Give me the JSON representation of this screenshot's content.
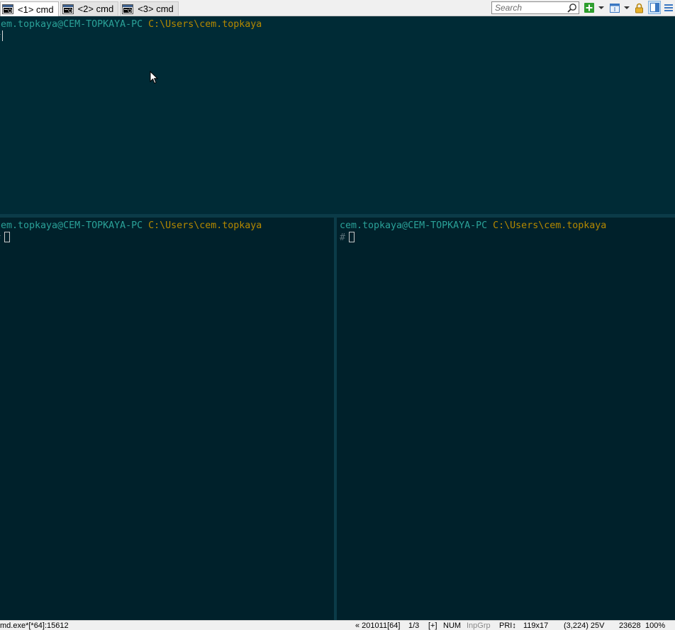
{
  "tabs": [
    {
      "label": "<1> cmd",
      "active": true
    },
    {
      "label": "<2> cmd",
      "active": false
    },
    {
      "label": "<3> cmd",
      "active": false
    }
  ],
  "search": {
    "placeholder": "Search"
  },
  "toolbar_icons": [
    "new-console-icon",
    "dropdown-arrow-icon",
    "layout-icon",
    "dropdown-arrow-icon",
    "lock-icon",
    "split-view-icon",
    "menu-icon"
  ],
  "colors": {
    "terminal_bg": "#002b36",
    "inactive_pane_bg": "#00212b",
    "prompt_user": "#2aa198",
    "prompt_path": "#b58900",
    "prompt_hash": "#586e75",
    "new_console_green": "#2e9e2e"
  },
  "panes": {
    "top": {
      "user_host": "cem.topkaya@CEM-TOPKAYA-PC",
      "path": "C:\\Users\\cem.topkaya",
      "prompt": "#"
    },
    "bottom_left": {
      "user_host": "cem.topkaya@CEM-TOPKAYA-PC",
      "path": "C:\\Users\\cem.topkaya",
      "prompt": "#"
    },
    "bottom_right": {
      "user_host": "cem.topkaya@CEM-TOPKAYA-PC",
      "path": "C:\\Users\\cem.topkaya",
      "prompt": "#"
    }
  },
  "status": {
    "process": "md.exe*[*64]:15612",
    "build": "« 201011[64]",
    "console_index": "1/3",
    "plus": "[+]",
    "num": "NUM",
    "inpgrp": "InpGrp",
    "pri": "PRI↕",
    "size": "119x17",
    "cursor_pos": "(3,224) 25V",
    "pid": "23628",
    "zoom": "100%"
  }
}
